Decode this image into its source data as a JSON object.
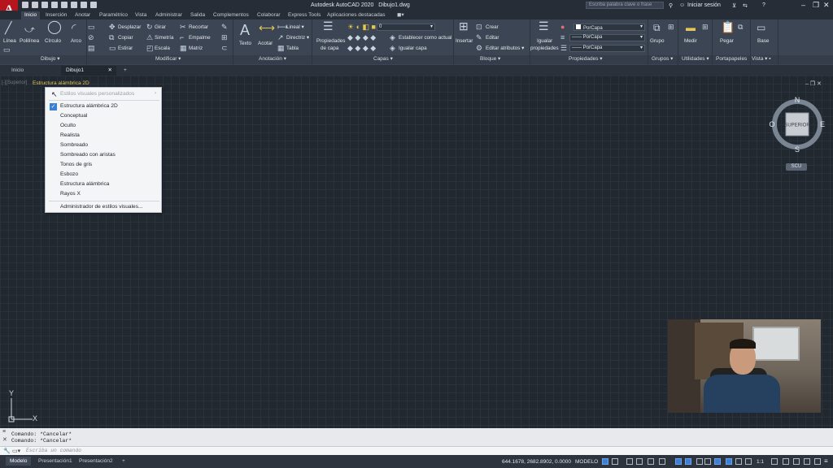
{
  "app": {
    "title": "Autodesk AutoCAD 2020",
    "document": "Dibujo1.dwg",
    "logo_letter": "A",
    "search_placeholder": "Escriba palabra clave o frase",
    "signin": "Iniciar sesión"
  },
  "ribbon_tabs": [
    "Inicio",
    "Inserción",
    "Anotar",
    "Paramétrico",
    "Vista",
    "Administrar",
    "Salida",
    "Complementos",
    "Colaborar",
    "Express Tools",
    "Aplicaciones destacadas"
  ],
  "ribbon": {
    "dibujo": {
      "label": "Dibujo",
      "items": [
        "Línea",
        "Polilínea",
        "Círculo",
        "Arco"
      ]
    },
    "modificar": {
      "label": "Modificar",
      "items": [
        "Desplazar",
        "Girar",
        "Recortar",
        "Copiar",
        "Simetría",
        "Empalme",
        "Estirar",
        "Escala",
        "Matriz"
      ]
    },
    "anotacion": {
      "label": "Anotación",
      "texto": "Texto",
      "acotar": "Acotar",
      "lineal": "Lineal",
      "directriz": "Directriz",
      "tabla": "Tabla"
    },
    "capas": {
      "label": "Capas",
      "propiedades": "Propiedades",
      "de_capa": "de capa",
      "layer_value": "0",
      "establecer": "Establecer como actual",
      "igualar": "Igualar capa"
    },
    "bloque": {
      "label": "Bloque",
      "insertar": "Insertar",
      "crear": "Crear",
      "editar": "Editar",
      "atributos": "Editar atributos"
    },
    "propiedades": {
      "label": "Propiedades",
      "igualar": "Igualar",
      "igualar2": "propiedades",
      "combo1": "PorCapa",
      "combo2": "PorCapa",
      "combo3": "PorCapa"
    },
    "grupos": {
      "label": "Grupos",
      "btn": "Grupo"
    },
    "utilidades": {
      "label": "Utilidades",
      "btn": "Medir"
    },
    "portapapeles": {
      "label": "Portapapeles",
      "btn": "Pegar"
    },
    "vista": {
      "label": "Vista",
      "btn": "Base"
    }
  },
  "doc_tabs": [
    "Inicio",
    "Dibujo1"
  ],
  "viewport": {
    "control_prefix": "[-][Superior]",
    "visual_style": "Estructura alámbrica 2D"
  },
  "menu": {
    "header": "Estilos visuales personalizados",
    "items": [
      "Estructura alámbrica 2D",
      "Conceptual",
      "Oculto",
      "Realista",
      "Sombreado",
      "Sombreado con aristas",
      "Tonos de gris",
      "Esbozo",
      "Estructura alámbrica",
      "Rayos X"
    ],
    "checked": "Estructura alámbrica 2D",
    "footer": "Administrador de estilos visuales..."
  },
  "viewcube": {
    "n": "N",
    "s": "S",
    "e": "E",
    "o": "O",
    "face": "SUPERIOR",
    "wcs": "SCU"
  },
  "ucs": {
    "x": "X",
    "y": "Y"
  },
  "command": {
    "history": [
      "Comando: *Cancelar*",
      "Comando: *Cancelar*"
    ],
    "placeholder": "Escriba un comando"
  },
  "layout_tabs": [
    "Modelo",
    "Presentación1",
    "Presentación2"
  ],
  "status": {
    "coords": "644.1678, 2682.8902, 0.0000",
    "model": "MODELO",
    "scale": "1:1"
  },
  "colors": {
    "accent": "#3a7fd6",
    "brand": "#b7151e",
    "bg": "#212830"
  }
}
